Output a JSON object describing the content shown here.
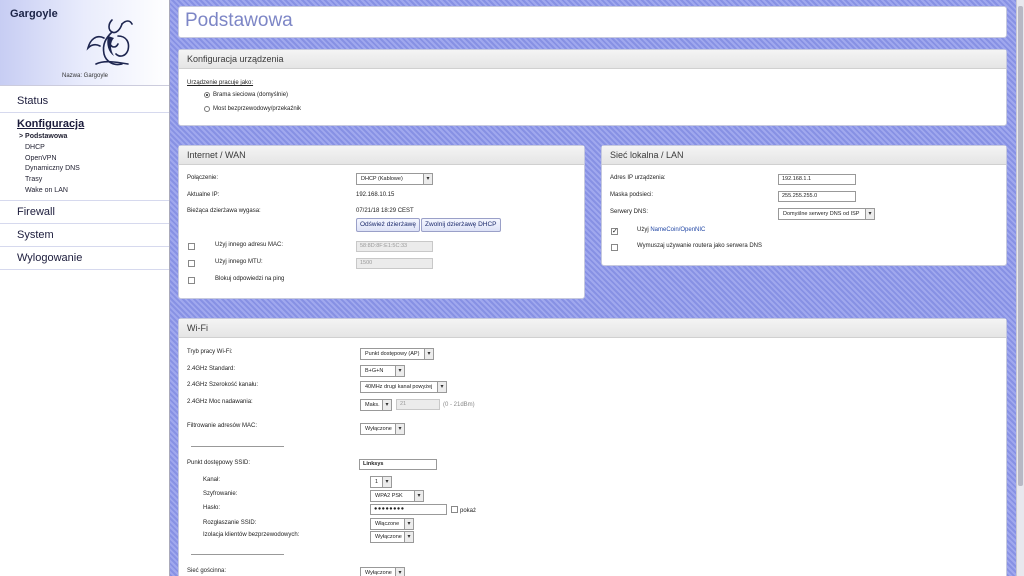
{
  "app": {
    "title": "Gargoyle",
    "device_name": "Nazwa: Gargoyle"
  },
  "nav": {
    "status": "Status",
    "config": "Konfiguracja",
    "sub": [
      {
        "label": "> Podstawowa"
      },
      {
        "label": "DHCP"
      },
      {
        "label": "OpenVPN"
      },
      {
        "label": "Dynamiczny DNS"
      },
      {
        "label": "Trasy"
      },
      {
        "label": "Wake on LAN"
      }
    ],
    "firewall": "Firewall",
    "system": "System",
    "logout": "Wylogowanie"
  },
  "page": {
    "title": "Podstawowa"
  },
  "device_config": {
    "header": "Konfiguracja urządzenia",
    "mode_label": "Urządzenie pracuje jako:",
    "options": [
      "Brama sieciowa (domyślnie)",
      "Most bezprzewodowy/przekaźnik"
    ],
    "selected": "Brama sieciowa (domyślnie)"
  },
  "wan": {
    "header": "Internet / WAN",
    "connection_label": "Połączenie:",
    "connection_value": "DHCP (Kablowe)",
    "ip_label": "Aktualne IP:",
    "ip_value": "192.168.10.15",
    "lease_label": "Bieżąca dzierżawa wygasa:",
    "lease_value": "07/21/18 18:29 CEST",
    "renew_button": "Odśwież dzierżawę",
    "release_button": "Zwolnij dzierżawę DHCP",
    "mac_label": "Użyj innego adresu MAC:",
    "mac_value": "58:8D:8F:E1:5C:33",
    "mtu_label": "Użyj innego MTU:",
    "mtu_value": "1500",
    "ping_label": "Blokuj odpowiedzi na ping"
  },
  "lan": {
    "header": "Sieć lokalna / LAN",
    "ip_label": "Adres IP urządzenia:",
    "ip_value": "192.168.1.1",
    "mask_label": "Maska podsieci:",
    "mask_value": "255.255.255.0",
    "dns_label": "Serwery DNS:",
    "dns_value": "Domyślne serwery DNS od ISP",
    "namecoin_prefix": "Użyj ",
    "namecoin_link": "NameCoin/OpenNIC",
    "force_dns_label": "Wymuszaj używanie routera jako serwera DNS"
  },
  "wifi": {
    "header": "Wi-Fi",
    "mode_label": "Tryb pracy Wi-Fi:",
    "mode_value": "Punkt dostępowy (AP)",
    "standard_label": "2.4GHz Standard:",
    "standard_value": "B+G+N",
    "width_label": "2.4GHz Szerokość kanału:",
    "width_value": "40MHz drugi kanał powyżej",
    "power_label": "2.4GHz Moc nadawania:",
    "power_value": "Maks.",
    "power_input": "21",
    "power_range": "(0 - 21dBm)",
    "mac_filter_label": "Filtrowanie adresów MAC:",
    "mac_filter_value": "Wyłączone",
    "ssid_label": "Punkt dostępowy SSID:",
    "ssid_value": "Linksys",
    "channel_label": "Kanał:",
    "channel_value": "1",
    "encryption_label": "Szyfrowanie:",
    "encryption_value": "WPA2 PSK",
    "password_label": "Hasło:",
    "password_value": "●●●●●●●●",
    "show_label": "pokaż",
    "broadcast_label": "Rozgłaszanie SSID:",
    "broadcast_value": "Włączone",
    "isolation_label": "Izolacja klientów bezprzewodowych:",
    "isolation_value": "Wyłączone",
    "guest_label": "Sieć gościnna:",
    "guest_value": "Wyłączone"
  }
}
